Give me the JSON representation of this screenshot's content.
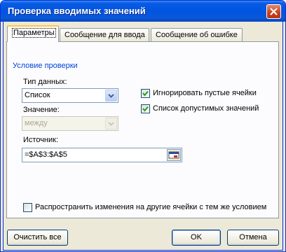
{
  "window": {
    "title": "Проверка вводимых значений"
  },
  "tabs": [
    {
      "label": "Параметры",
      "active": true
    },
    {
      "label": "Сообщение для ввода",
      "active": false
    },
    {
      "label": "Сообщение об ошибке",
      "active": false
    }
  ],
  "validation": {
    "group_label": "Условие проверки",
    "data_type": {
      "label": "Тип данных:",
      "value": "Список"
    },
    "value": {
      "label": "Значение:",
      "value": "между"
    },
    "source": {
      "label": "Источник:",
      "value": "=$A$3:$A$5"
    },
    "ignore_blank": {
      "label": "Игнорировать пустые ячейки",
      "checked": true
    },
    "in_cell_dropdown": {
      "label": "Список допустимых значений",
      "checked": true
    }
  },
  "apply_all": {
    "label": "Распространить изменения на другие ячейки с тем же условием",
    "checked": false
  },
  "buttons": {
    "clear": "Очистить все",
    "ok": "OK",
    "cancel": "Отмена"
  },
  "colors": {
    "title_bar": "#0054e3",
    "group_label": "#0046d5",
    "check": "#21a121"
  }
}
